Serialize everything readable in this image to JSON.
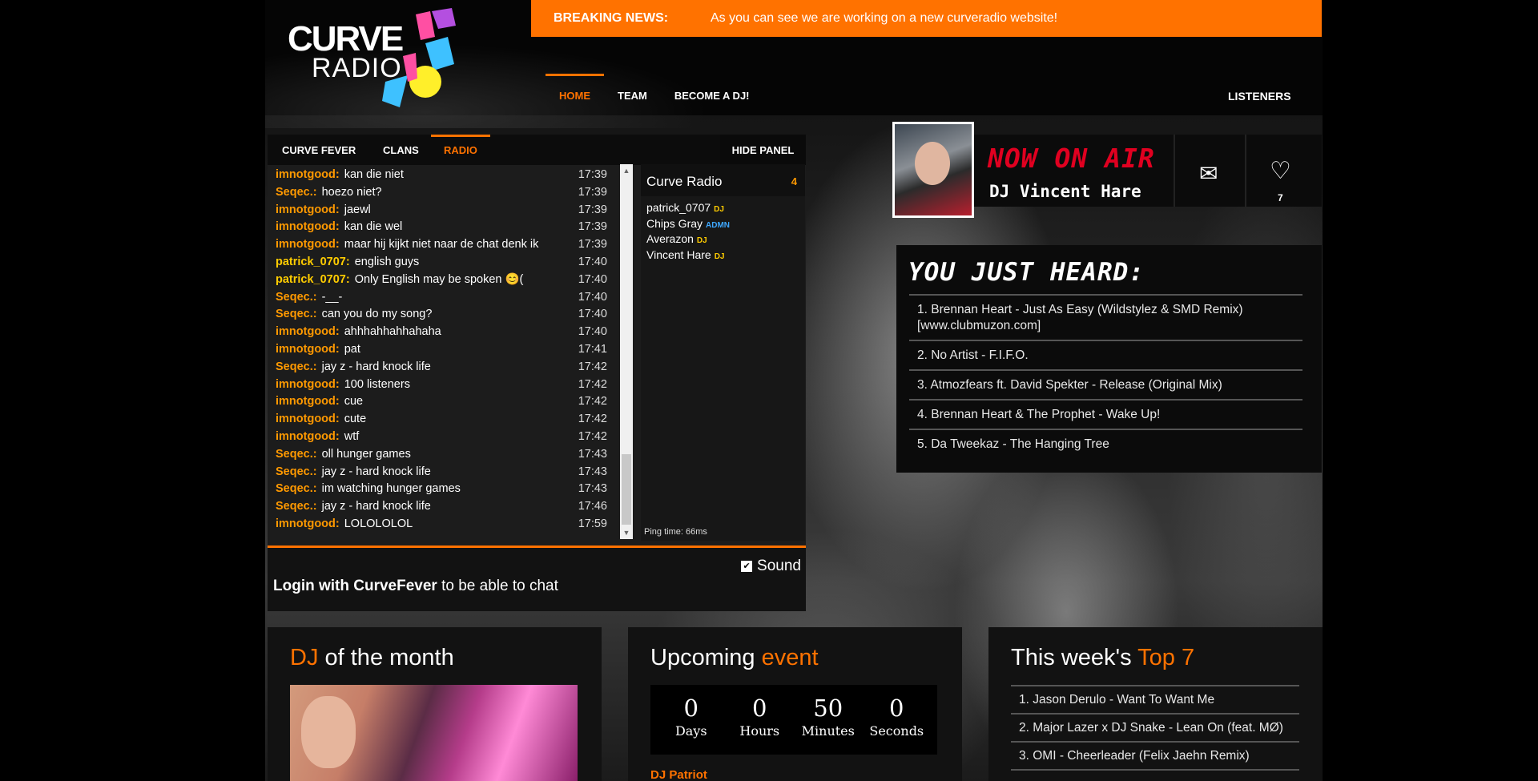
{
  "logo": {
    "line1": "CURVE",
    "line2": "RADIO"
  },
  "news": {
    "label": "BREAKING NEWS:",
    "text": "As you can see we are working on a new curveradio website!"
  },
  "nav": {
    "items": [
      {
        "label": "HOME",
        "active": true
      },
      {
        "label": "TEAM"
      },
      {
        "label": "BECOME A DJ!"
      }
    ],
    "listeners": "LISTENERS"
  },
  "chat": {
    "tabs": [
      "CURVE FEVER",
      "CLANS",
      "RADIO"
    ],
    "hide_panel": "HIDE PANEL",
    "messages": [
      {
        "user": "imnotgood:",
        "text": "kan die niet",
        "time": "17:39"
      },
      {
        "user": "Seqec.:",
        "text": "hoezo niet?",
        "time": "17:39"
      },
      {
        "user": "imnotgood:",
        "text": "jaewl",
        "time": "17:39"
      },
      {
        "user": "imnotgood:",
        "text": "kan die wel",
        "time": "17:39"
      },
      {
        "user": "imnotgood:",
        "text": "maar hij kijkt niet naar de chat denk ik",
        "time": "17:39"
      },
      {
        "user": "patrick_0707:",
        "text": "english guys",
        "time": "17:40"
      },
      {
        "user": "patrick_0707:",
        "text": "Only English may be spoken 😊(",
        "time": "17:40"
      },
      {
        "user": "Seqec.:",
        "text": "-__-",
        "time": "17:40"
      },
      {
        "user": "Seqec.:",
        "text": "can you do my song?",
        "time": "17:40"
      },
      {
        "user": "imnotgood:",
        "text": "ahhhahhahhahaha",
        "time": "17:40"
      },
      {
        "user": "imnotgood:",
        "text": "pat",
        "time": "17:41"
      },
      {
        "user": "Seqec.:",
        "text": "jay z - hard knock life",
        "time": "17:42"
      },
      {
        "user": "imnotgood:",
        "text": "100 listeners",
        "time": "17:42"
      },
      {
        "user": "imnotgood:",
        "text": "cue",
        "time": "17:42"
      },
      {
        "user": "imnotgood:",
        "text": "cute",
        "time": "17:42"
      },
      {
        "user": "imnotgood:",
        "text": "wtf",
        "time": "17:42"
      },
      {
        "user": "Seqec.:",
        "text": "oll hunger games",
        "time": "17:43"
      },
      {
        "user": "Seqec.:",
        "text": "jay z - hard knock life",
        "time": "17:43"
      },
      {
        "user": "Seqec.:",
        "text": "im watching hunger games",
        "time": "17:43"
      },
      {
        "user": "Seqec.:",
        "text": "jay z - hard knock life",
        "time": "17:46"
      },
      {
        "user": "imnotgood:",
        "text": "LOLOLOLOL",
        "time": "17:59"
      }
    ],
    "room": {
      "name": "Curve Radio",
      "count": "4"
    },
    "users": [
      {
        "name": "patrick_0707",
        "role": "DJ"
      },
      {
        "name": "Chips Gray",
        "role": "ADMN"
      },
      {
        "name": "Averazon",
        "role": "DJ"
      },
      {
        "name": "Vincent Hare",
        "role": "DJ"
      }
    ],
    "ping": "Ping time: 66ms",
    "login_bold": "Login with CurveFever",
    "login_rest": " to be able to chat",
    "sound_label": "Sound"
  },
  "now_on_air": {
    "label": "NOW ON AIR",
    "dj": "DJ Vincent Hare",
    "likes": "7"
  },
  "just_heard": {
    "title": "YOU JUST HEARD:",
    "tracks": [
      "1. Brennan Heart - Just As Easy (Wildstylez & SMD Remix) [www.clubmuzon.com]",
      "2. No Artist - F.I.F.O.",
      "3. Atmozfears ft. David Spekter - Release (Original Mix)",
      "4. Brennan Heart & The Prophet - Wake Up!",
      "5. Da Tweekaz - The Hanging Tree"
    ]
  },
  "dj_of_month": {
    "accent": "DJ",
    "rest": " of the month"
  },
  "upcoming": {
    "rest": "Upcoming ",
    "accent": "event",
    "countdown": [
      {
        "num": "0",
        "unit": "Days"
      },
      {
        "num": "0",
        "unit": "Hours"
      },
      {
        "num": "50",
        "unit": "Minutes"
      },
      {
        "num": "0",
        "unit": "Seconds"
      }
    ],
    "dj": "DJ Patriot"
  },
  "top7": {
    "rest": "This week's ",
    "accent": "Top 7",
    "tracks": [
      "1. Jason Derulo - Want To Want Me",
      "2. Major Lazer x DJ Snake - Lean On (feat. MØ)",
      "3. OMI - Cheerleader (Felix Jaehn Remix)"
    ]
  },
  "colors": {
    "accent": "#ff7200",
    "now_on_air_red": "#e00020",
    "dj_badge": "#ffcc00",
    "admn_badge": "#3ea8ff"
  }
}
